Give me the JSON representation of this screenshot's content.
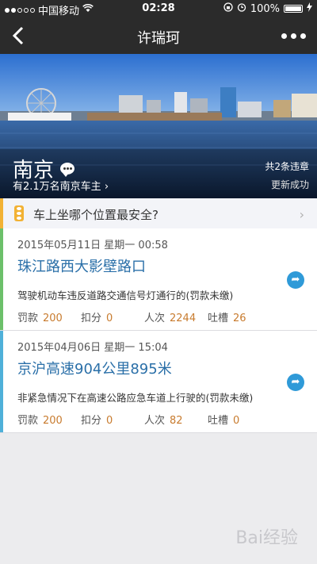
{
  "status_bar": {
    "carrier": "中国移动",
    "time": "02:28",
    "battery": "100%"
  },
  "nav": {
    "title": "许瑞珂"
  },
  "hero": {
    "city": "南京",
    "owners": "有2.1万名南京车主",
    "violation_count": "共2条违章",
    "update_status": "更新成功"
  },
  "tip": {
    "text": "车上坐哪个位置最安全?"
  },
  "violations": [
    {
      "date": "2015年05月11日 星期一 00:58",
      "address": "珠江路西大影壁路口",
      "description": "驾驶机动车违反道路交通信号灯通行的(罚款未缴)",
      "fine_label": "罚款",
      "fine": "200",
      "points_label": "扣分",
      "points": "0",
      "count_label": "人次",
      "count": "2244",
      "comments_label": "吐槽",
      "comments": "26",
      "accent_color": "#6cc06a"
    },
    {
      "date": "2015年04月06日 星期一 15:04",
      "address": "京沪高速904公里895米",
      "description": "非紧急情况下在高速公路应急车道上行驶的(罚款未缴)",
      "fine_label": "罚款",
      "fine": "200",
      "points_label": "扣分",
      "points": "0",
      "count_label": "人次",
      "count": "82",
      "comments_label": "吐槽",
      "comments": "0",
      "accent_color": "#4fb0d9"
    }
  ],
  "watermark": "Bai经验",
  "colors": {
    "bar_bg": "#2b2b2b",
    "tip_accent": "#f2b234",
    "link_blue": "#2a6fa8",
    "value_orange": "#c87b2e",
    "share_blue": "#2f9ad8"
  }
}
